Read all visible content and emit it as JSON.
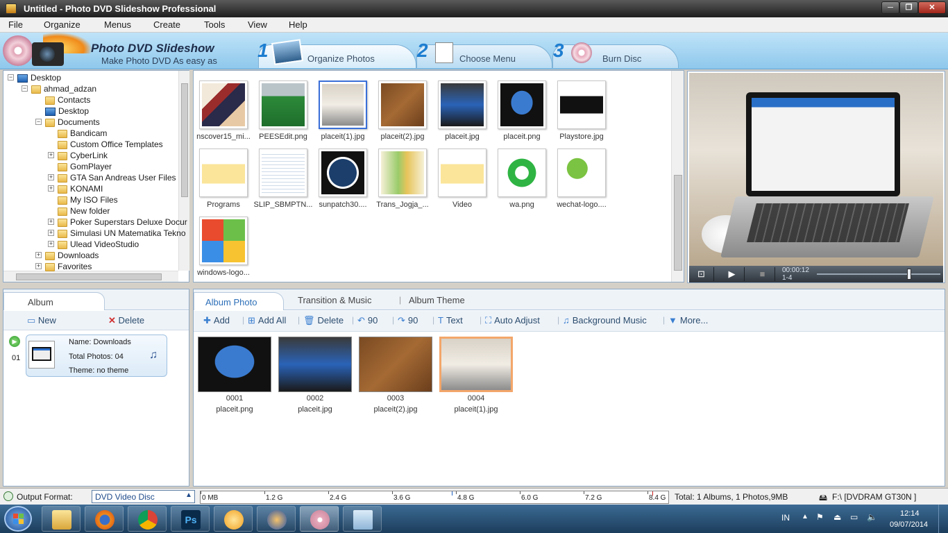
{
  "window": {
    "title": "Untitled - Photo DVD Slideshow Professional",
    "buttons": [
      "─",
      "❐",
      "✕"
    ]
  },
  "menu": [
    "File",
    "Organize",
    "Menus",
    "Create",
    "Tools",
    "View",
    "Help"
  ],
  "banner": {
    "title": "Photo DVD Slideshow",
    "subtitle": "Make Photo DVD As easy as",
    "steps": [
      {
        "num": "1",
        "label": "Organize Photos"
      },
      {
        "num": "2",
        "label": "Choose Menu"
      },
      {
        "num": "3",
        "label": "Burn Disc"
      }
    ]
  },
  "tree": [
    {
      "label": "Desktop",
      "icon": "pc"
    },
    {
      "label": "ahmad_adzan",
      "icon": "folder"
    },
    {
      "label": "Contacts",
      "icon": "folder"
    },
    {
      "label": "Desktop",
      "icon": "pc"
    },
    {
      "label": "Documents",
      "icon": "folder"
    },
    {
      "label": "Bandicam",
      "icon": "folder"
    },
    {
      "label": "Custom Office Templates",
      "icon": "folder"
    },
    {
      "label": "CyberLink",
      "icon": "folder"
    },
    {
      "label": "GomPlayer",
      "icon": "folder"
    },
    {
      "label": "GTA San Andreas User Files",
      "icon": "folder"
    },
    {
      "label": "KONAMI",
      "icon": "folder"
    },
    {
      "label": "My ISO Files",
      "icon": "folder"
    },
    {
      "label": "New folder",
      "icon": "folder"
    },
    {
      "label": "Poker Superstars Deluxe Docur",
      "icon": "folder"
    },
    {
      "label": "Simulasi UN Matematika Tekno",
      "icon": "folder"
    },
    {
      "label": "Ulead VideoStudio",
      "icon": "folder"
    },
    {
      "label": "Downloads",
      "icon": "folder"
    },
    {
      "label": "Favorites",
      "icon": "folder"
    }
  ],
  "files": [
    {
      "name": "nscover15_mi...",
      "kind": "anime"
    },
    {
      "name": "PEESEdit.png",
      "kind": "green"
    },
    {
      "name": "placeit(1).jpg",
      "kind": "laptop",
      "selected": true
    },
    {
      "name": "placeit(2).jpg",
      "kind": "desk"
    },
    {
      "name": "placeit.jpg",
      "kind": "tablet"
    },
    {
      "name": "placeit.png",
      "kind": "monitor"
    },
    {
      "name": "Playstore.jpg",
      "kind": "playstore"
    },
    {
      "name": "Programs",
      "kind": "folder"
    },
    {
      "name": "SLIP_SBMPTN...",
      "kind": "doc"
    },
    {
      "name": "sunpatch30....",
      "kind": "sport"
    },
    {
      "name": "Trans_Jogja_...",
      "kind": "map"
    },
    {
      "name": "Video",
      "kind": "folder"
    },
    {
      "name": "wa.png",
      "kind": "whatsapp"
    },
    {
      "name": "wechat-logo....",
      "kind": "wechat"
    },
    {
      "name": "windows-logo...",
      "kind": "windows"
    }
  ],
  "preview": {
    "time": "00:00:12",
    "index": "1-4",
    "controls": [
      "⊡",
      "▶",
      "■"
    ]
  },
  "album_panel": {
    "tab": "Album",
    "new_label": "New",
    "delete_label": "Delete",
    "item": {
      "index": "01",
      "name": "Name: Downloads",
      "total": "Total Photos: 04",
      "theme": "Theme: no theme"
    }
  },
  "album_tabs": [
    "Album Photo",
    "Transition & Music",
    "Album Theme"
  ],
  "toolbar": [
    {
      "icon": "✚",
      "label": "Add"
    },
    {
      "icon": "⊞",
      "label": "Add All"
    },
    {
      "icon": "🗑",
      "label": "Delete"
    },
    {
      "icon": "↶",
      "label": "90"
    },
    {
      "icon": "↷",
      "label": "90"
    },
    {
      "icon": "T",
      "label": "Text"
    },
    {
      "icon": "⛶",
      "label": "Auto Adjust"
    },
    {
      "icon": "♫",
      "label": "Background Music"
    },
    {
      "icon": "▼",
      "label": "More..."
    }
  ],
  "album_photos": [
    {
      "num": "0001",
      "name": "placeit.png"
    },
    {
      "num": "0002",
      "name": "placeit.jpg"
    },
    {
      "num": "0003",
      "name": "placeit(2).jpg"
    },
    {
      "num": "0004",
      "name": "placeit(1).jpg",
      "selected": true
    }
  ],
  "status": {
    "output_label": "Output Format:",
    "output_value": "DVD Video Disc",
    "ruler": [
      "0 MB",
      "1.2 G",
      "2.4 G",
      "3.6 G",
      "4.8 G",
      "6.0 G",
      "7.2 G",
      "8.4 G"
    ],
    "total": "Total: 1 Albums, 1 Photos,9MB",
    "drive": "F:\\ [DVDRAM GT30N ]"
  },
  "taskbar": {
    "lang": "IN",
    "time": "12:14",
    "date": "09/07/2014"
  }
}
